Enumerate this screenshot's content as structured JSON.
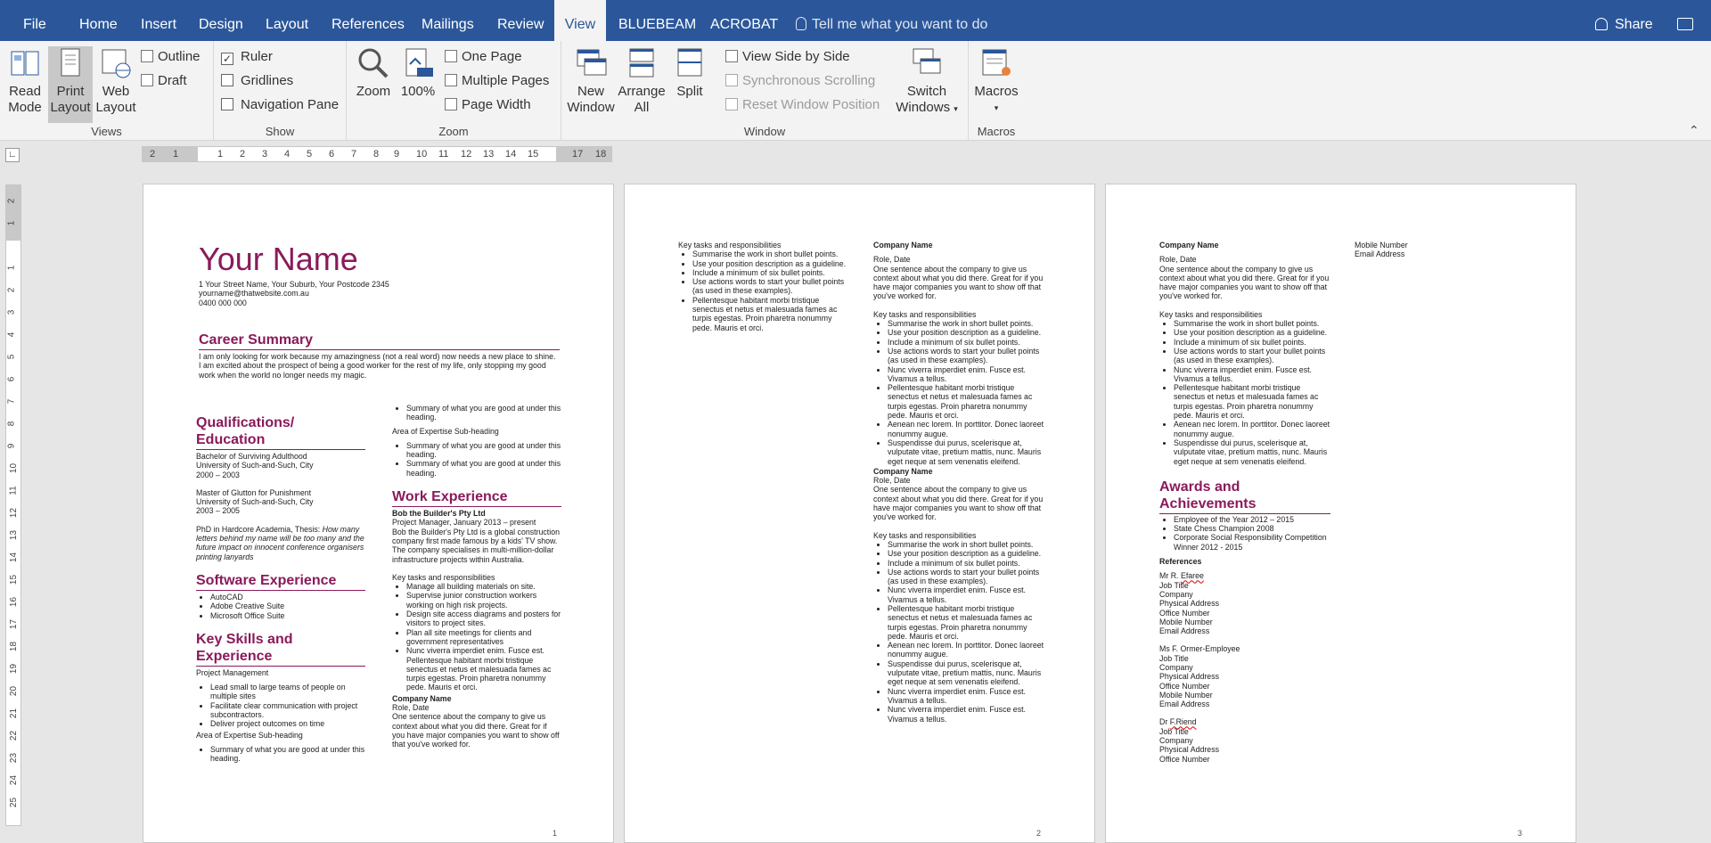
{
  "tabs": [
    {
      "label": "File"
    },
    {
      "label": "Home"
    },
    {
      "label": "Insert"
    },
    {
      "label": "Design"
    },
    {
      "label": "Layout"
    },
    {
      "label": "References"
    },
    {
      "label": "Mailings"
    },
    {
      "label": "Review"
    },
    {
      "label": "View",
      "active": true
    },
    {
      "label": "BLUEBEAM"
    },
    {
      "label": "ACROBAT"
    }
  ],
  "tell_me": "Tell me what you want to do",
  "share": "Share",
  "ribbon": {
    "views": {
      "name": "Views",
      "read_mode": [
        "Read",
        "Mode"
      ],
      "print_layout": [
        "Print",
        "Layout"
      ],
      "web_layout": [
        "Web",
        "Layout"
      ],
      "outline": "Outline",
      "draft": "Draft"
    },
    "show": {
      "name": "Show",
      "ruler": "Ruler",
      "gridlines": "Gridlines",
      "nav_pane": "Navigation Pane"
    },
    "zoom": {
      "name": "Zoom",
      "zoom": "Zoom",
      "hundred": "100%",
      "one_page": "One Page",
      "multiple_pages": "Multiple Pages",
      "page_width": "Page Width"
    },
    "window": {
      "name": "Window",
      "new_window": [
        "New",
        "Window"
      ],
      "arrange_all": [
        "Arrange",
        "All"
      ],
      "split": "Split",
      "side_by_side": "View Side by Side",
      "sync_scroll": "Synchronous Scrolling",
      "reset_pos": "Reset Window Position",
      "switch_windows": [
        "Switch",
        "Windows"
      ]
    },
    "macros": {
      "name": "Macros",
      "macros": "Macros"
    }
  },
  "ruler": {
    "h": [
      "2",
      "1",
      "1",
      "2",
      "3",
      "4",
      "5",
      "6",
      "7",
      "8",
      "9",
      "10",
      "11",
      "12",
      "13",
      "14",
      "15",
      "17",
      "18"
    ],
    "v": [
      "2",
      "1",
      "1",
      "2",
      "3",
      "4",
      "5",
      "6",
      "7",
      "8",
      "9",
      "10",
      "11",
      "12",
      "13",
      "14",
      "15",
      "16",
      "17",
      "18",
      "19",
      "20",
      "21",
      "22",
      "23",
      "24",
      "25"
    ]
  },
  "page1": {
    "name": "Your Name",
    "address": "1 Your Street Name, Your Suburb, Your Postcode 2345",
    "email": "yourname@thatwebsite.com.au",
    "phone": "0400 000 000",
    "career_h": "Career Summary",
    "career_text": "I am only looking for work because my amazingness (not a real word) now needs a new place to shine. I am excited about the prospect of being a good worker for the rest of my life, only stopping my good work when the world no longer needs my magic.",
    "qual_h": [
      "Qualifications/",
      "Education"
    ],
    "qual1": [
      "Bachelor of Surviving Adulthood",
      "University of Such-and-Such, City",
      "2000 – 2003"
    ],
    "qual2": [
      "Master of Glutton for Punishment",
      "University of Such-and-Such, City",
      "2003 – 2005"
    ],
    "qual3_a": "PhD in Hardcore Academia, Thesis: ",
    "qual3_b": "How many letters behind my name will be too many and the future impact on innocent conference organisers printing lanyards",
    "software_h": "Software Experience",
    "software": [
      "AutoCAD",
      "Adobe Creative Suite",
      "Microsoft Office Suite"
    ],
    "skills_h": [
      "Key Skills and",
      "Experience"
    ],
    "skills_sub": "Project Management",
    "skills": [
      "Lead small to large teams of people on multiple sites",
      "Facilitate clear communication with project subcontractors.",
      "Deliver project outcomes on time"
    ],
    "area_sub": "Area of Expertise Sub-heading",
    "area_items": [
      "Summary of what you are good at under this heading."
    ],
    "right_top": [
      "Summary of what you are good at under this heading."
    ],
    "right_area": "Area of Expertise Sub-heading",
    "right_items": [
      "Summary of what you are good at under this heading.",
      "Summary of what you are good at under this heading."
    ],
    "work_h": "Work Experience",
    "work_co": "Bob the Builder's Pty Ltd",
    "work_role": "Project Manager, January 2013 – present",
    "work_desc": "Bob the Builder's Pty Ltd is a global construction company first made famous by a kids' TV show. The company specialises in multi-million-dollar infrastructure projects within Australia.",
    "tasks_h": "Key tasks and responsibilities",
    "tasks": [
      "Manage all building materials on site.",
      "Supervise junior construction workers working on high risk projects.",
      "Design site access diagrams and posters for visitors to project sites.",
      "Plan all site meetings for clients and government representatives",
      "Nunc viverra imperdiet enim. Fusce est. Pellentesque habitant morbi tristique senectus et netus et malesuada fames ac turpis egestas. Proin pharetra nonummy pede. Mauris et orci."
    ],
    "co2": "Company Name",
    "role2": "Role, Date",
    "desc2": "One sentence about the company to give us context about what you did there. Great for if you have major companies you want to show off that you've worked for.",
    "num": "1"
  },
  "page2": {
    "left_h": "Key tasks and responsibilities",
    "left_items": [
      "Summarise the work in short bullet points.",
      "Use your position description as a guideline.",
      "Include a minimum of six bullet points.",
      "Use actions words to start your bullet points (as used in these examples).",
      "Pellentesque habitant morbi tristique senectus et netus et malesuada fames ac turpis egestas. Proin pharetra nonummy pede. Mauris et orci."
    ],
    "co": "Company Name",
    "role": "Role, Date",
    "desc": "One sentence about the company to give us context about what you did there. Great for if you have major companies you want to show off that you've worked for.",
    "tasks_h": "Key tasks and responsibilities",
    "items_a": [
      "Summarise the work in short bullet points.",
      "Use your position description as a guideline.",
      "Include a minimum of six bullet points.",
      "Use actions words to start your bullet points (as used in these examples).",
      "Nunc viverra imperdiet enim. Fusce est. Vivamus a tellus.",
      "Pellentesque habitant morbi tristique senectus et netus et malesuada fames ac turpis egestas. Proin pharetra nonummy pede. Mauris et orci.",
      "Aenean nec lorem. In porttitor. Donec laoreet nonummy augue.",
      "Suspendisse dui purus, scelerisque at, vulputate vitae, pretium mattis, nunc. Mauris eget neque at sem venenatis eleifend."
    ],
    "co_b": "Company Name",
    "role_b": "Role, Date",
    "desc_b": "One sentence about the company to give us context about what you did there. Great for if you have major companies you want to show off that you've worked for.",
    "tasks_h_b": "Key tasks and responsibilities",
    "items_b": [
      "Summarise the work in short bullet points.",
      "Use your position description as a guideline.",
      "Include a minimum of six bullet points.",
      "Use actions words to start your bullet points (as used in these examples).",
      "Nunc viverra imperdiet enim. Fusce est. Vivamus a tellus.",
      "Pellentesque habitant morbi tristique senectus et netus et malesuada fames ac turpis egestas. Proin pharetra nonummy pede. Mauris et orci.",
      "Aenean nec lorem. In porttitor. Donec laoreet nonummy augue.",
      "Suspendisse dui purus, scelerisque at, vulputate vitae, pretium mattis, nunc. Mauris eget neque at sem venenatis eleifend.",
      "Nunc viverra imperdiet enim. Fusce est. Vivamus a tellus.",
      "Nunc viverra imperdiet enim. Fusce est. Vivamus a tellus."
    ],
    "num": "2"
  },
  "page3": {
    "co": "Company Name",
    "role": "Role, Date",
    "desc": "One sentence about the company to give us context about what you did there. Great for if you have major companies you want to show off that you've worked for.",
    "tasks_h": "Key tasks and responsibilities",
    "items": [
      "Summarise the work in short bullet points.",
      "Use your position description as a guideline.",
      "Include a minimum of six bullet points.",
      "Use actions words to start your bullet points (as used in these examples).",
      "Nunc viverra imperdiet enim. Fusce est. Vivamus a tellus.",
      "Pellentesque habitant morbi tristique senectus et netus et malesuada fames ac turpis egestas. Proin pharetra nonummy pede. Mauris et orci.",
      "Aenean nec lorem. In porttitor. Donec laoreet nonummy augue.",
      "Suspendisse dui purus, scelerisque at, vulputate vitae, pretium mattis, nunc. Mauris eget neque at sem venenatis eleifend."
    ],
    "awards_h": [
      "Awards and",
      "Achievements"
    ],
    "awards": [
      "Employee of the Year 2012 – 2015",
      "State Chess Champion 2008",
      "Corporate Social Responsibility Competition Winner 2012 - 2015"
    ],
    "refs_h": "References",
    "ref1": [
      "Mr R. ",
      "Efaree",
      "Job Title",
      "Company",
      "Physical Address",
      "Office Number",
      "Mobile Number",
      "Email Address"
    ],
    "ref2": [
      "Ms F. Ormer-Employee",
      "Job Title",
      "Company",
      "Physical Address",
      "Office Number",
      "Mobile Number",
      "Email Address"
    ],
    "ref3": [
      "Dr ",
      "F.Riend",
      "Job Title",
      "Company",
      "Physical Address",
      "Office Number"
    ],
    "right": [
      "Mobile Number",
      "Email Address"
    ],
    "num": "3"
  }
}
